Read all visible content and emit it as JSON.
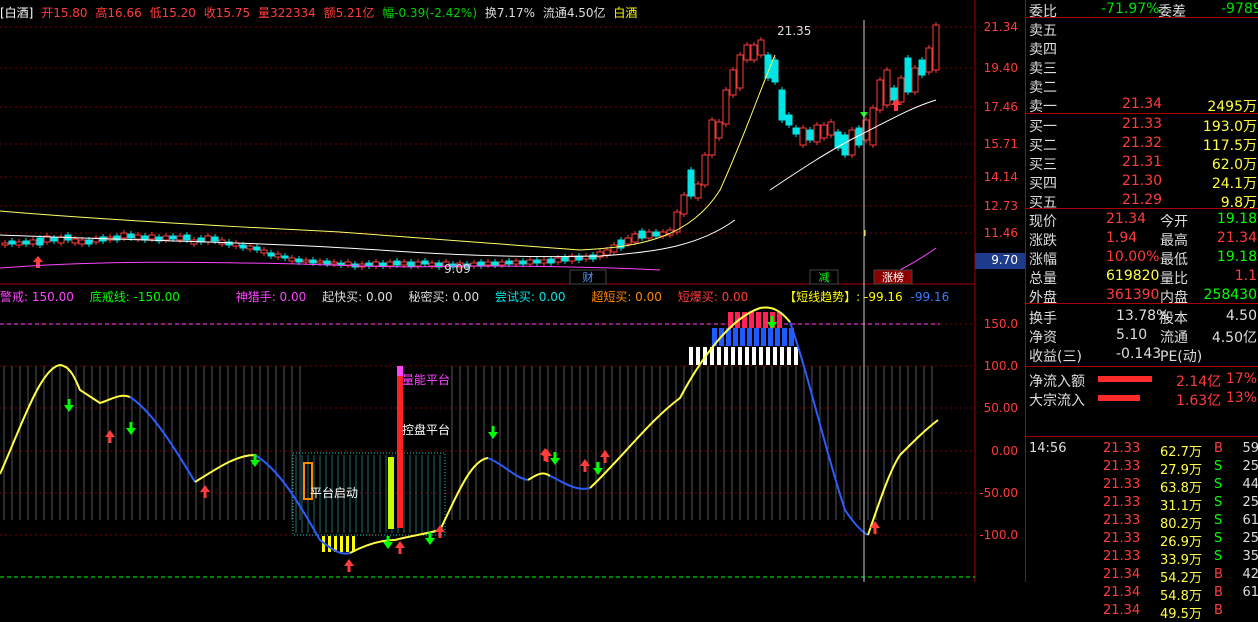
{
  "header": {
    "name": "[白酒]",
    "open": "开15.80",
    "high": "高16.66",
    "low": "低15.20",
    "close": "收15.75",
    "volume": "量322334",
    "amount": "额5.21亿",
    "change": "幅-0.39(-2.42%)",
    "turnover": "换7.17%",
    "float_cap": "流通4.50亿",
    "sector": "白酒"
  },
  "main_axis": [
    "21.34",
    "19.40",
    "17.46",
    "15.71",
    "14.14",
    "12.73",
    "11.46",
    "9.70"
  ],
  "annotations": {
    "high_mark": "21.35",
    "low_mark": "9.09"
  },
  "event_flags": [
    "财",
    "减",
    "涨榜"
  ],
  "indicator_bar": {
    "a": "警戒: 150.00",
    "b": "底戒线: -150.00",
    "c": "神猎手: 0.00",
    "d": "起快买: 0.00",
    "e": "秘密买: 0.00",
    "f": "尝试买: 0.00",
    "g": "超短买: 0.00",
    "h": "短爆买: 0.00",
    "i": "【短线趋势】: -99.16",
    "j": "-99.16"
  },
  "sub_axis": [
    "150.0",
    "100.0",
    "50.00",
    "0.00",
    "-50.00",
    "-100.0"
  ],
  "sub_labels": {
    "l1": "量能平台",
    "l2": "控盘平台",
    "l3": "平台启动"
  },
  "quote": {
    "wei_bi_label": "委比",
    "wei_bi": "-71.97%",
    "wei_cha_label": "委差",
    "wei_cha": "-9789",
    "sells": [
      {
        "label": "卖五",
        "price": "",
        "vol": ""
      },
      {
        "label": "卖四",
        "price": "",
        "vol": ""
      },
      {
        "label": "卖三",
        "price": "",
        "vol": ""
      },
      {
        "label": "卖二",
        "price": "",
        "vol": ""
      },
      {
        "label": "卖一",
        "price": "21.34",
        "vol": "2495万"
      }
    ],
    "buys": [
      {
        "label": "买一",
        "price": "21.33",
        "vol": "193.0万"
      },
      {
        "label": "买二",
        "price": "21.32",
        "vol": "117.5万"
      },
      {
        "label": "买三",
        "price": "21.31",
        "vol": "62.0万"
      },
      {
        "label": "买四",
        "price": "21.30",
        "vol": "24.1万"
      },
      {
        "label": "买五",
        "price": "21.29",
        "vol": "9.8万"
      }
    ],
    "stats": [
      {
        "l1": "现价",
        "v1": "21.34",
        "l2": "今开",
        "v2": "19.18"
      },
      {
        "l1": "涨跌",
        "v1": "1.94",
        "l2": "最高",
        "v2": "21.34"
      },
      {
        "l1": "涨幅",
        "v1": "10.00%",
        "l2": "最低",
        "v2": "19.18"
      },
      {
        "l1": "总量",
        "v1": "619820",
        "l2": "量比",
        "v2": "1.1"
      },
      {
        "l1": "外盘",
        "v1": "361390",
        "l2": "内盘",
        "v2": "258430"
      }
    ],
    "stats2": [
      {
        "l1": "换手",
        "v1": "13.78%",
        "l2": "股本",
        "v2": "4.50"
      },
      {
        "l1": "净资",
        "v1": "5.10",
        "l2": "流通",
        "v2": "4.50亿"
      },
      {
        "l1": "收益(三)",
        "v1": "-0.143",
        "l2": "PE(动)",
        "v2": ""
      }
    ],
    "flows": [
      {
        "label": "净流入额",
        "value": "2.14亿",
        "pct": "17%"
      },
      {
        "label": "大宗流入",
        "value": "1.63亿",
        "pct": "13%"
      }
    ],
    "ticks": [
      {
        "t": "14:56",
        "p": "21.33",
        "v": "62.7万",
        "s": "B",
        "n": "59"
      },
      {
        "t": "",
        "p": "21.33",
        "v": "27.9万",
        "s": "S",
        "n": "25"
      },
      {
        "t": "",
        "p": "21.33",
        "v": "63.8万",
        "s": "S",
        "n": "44"
      },
      {
        "t": "",
        "p": "21.33",
        "v": "31.1万",
        "s": "S",
        "n": "25"
      },
      {
        "t": "",
        "p": "21.33",
        "v": "80.2万",
        "s": "S",
        "n": "61"
      },
      {
        "t": "",
        "p": "21.33",
        "v": "26.9万",
        "s": "S",
        "n": "25"
      },
      {
        "t": "",
        "p": "21.33",
        "v": "33.9万",
        "s": "S",
        "n": "35"
      },
      {
        "t": "",
        "p": "21.34",
        "v": "54.2万",
        "s": "B",
        "n": "42"
      },
      {
        "t": "",
        "p": "21.34",
        "v": "54.8万",
        "s": "B",
        "n": "61"
      },
      {
        "t": "",
        "p": "21.34",
        "v": "49.5万",
        "s": "B",
        "n": ""
      }
    ]
  },
  "colors": {
    "up": "#ff3c3c",
    "down": "#00e5e5",
    "flat": "#e0e0e0",
    "grid": "#7a0000"
  }
}
